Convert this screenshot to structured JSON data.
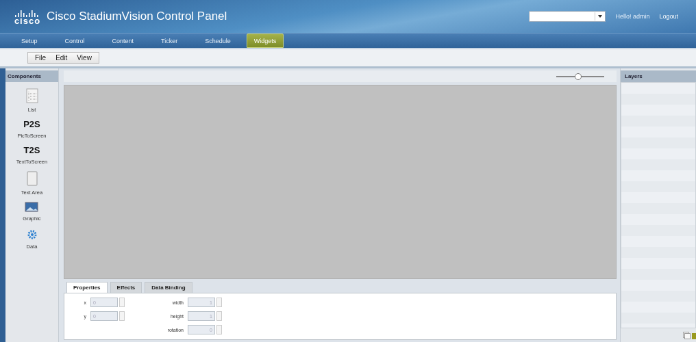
{
  "header": {
    "logo": "cisco",
    "title": "Cisco StadiumVision Control Panel",
    "user": "Hello! admin",
    "logout": "Logout"
  },
  "nav": [
    {
      "label": "Setup",
      "selected": false
    },
    {
      "label": "Control",
      "selected": false
    },
    {
      "label": "Content",
      "selected": false
    },
    {
      "label": "Ticker",
      "selected": false
    },
    {
      "label": "Schedule",
      "selected": false
    },
    {
      "label": "Widgets",
      "selected": true
    }
  ],
  "menu": [
    "File",
    "Edit",
    "View"
  ],
  "components": {
    "title": "Components",
    "items": [
      {
        "kind": "list",
        "label": "List"
      },
      {
        "kind": "glyph",
        "glyph": "P2S",
        "label": "PicToScreen"
      },
      {
        "kind": "glyph",
        "glyph": "T2S",
        "label": "TextToScreen"
      },
      {
        "kind": "textarea",
        "label": "Text Area"
      },
      {
        "kind": "graphic",
        "label": "Graphic"
      },
      {
        "kind": "data",
        "label": "Data"
      }
    ]
  },
  "zoom": {
    "level": 0.45
  },
  "properties": {
    "tabs": [
      {
        "label": "Properties",
        "selected": true
      },
      {
        "label": "Effects",
        "selected": false
      },
      {
        "label": "Data Binding",
        "selected": false
      }
    ],
    "fields": [
      {
        "label": "x",
        "value": "0",
        "disabled": true
      },
      {
        "label": "width",
        "value": "1",
        "disabled": true
      },
      {
        "label": "y",
        "value": "0",
        "disabled": true
      },
      {
        "label": "height",
        "value": "1",
        "disabled": true
      },
      {
        "label": "rotation",
        "value": "0",
        "disabled": true
      }
    ]
  },
  "layers": {
    "title": "Layers"
  }
}
